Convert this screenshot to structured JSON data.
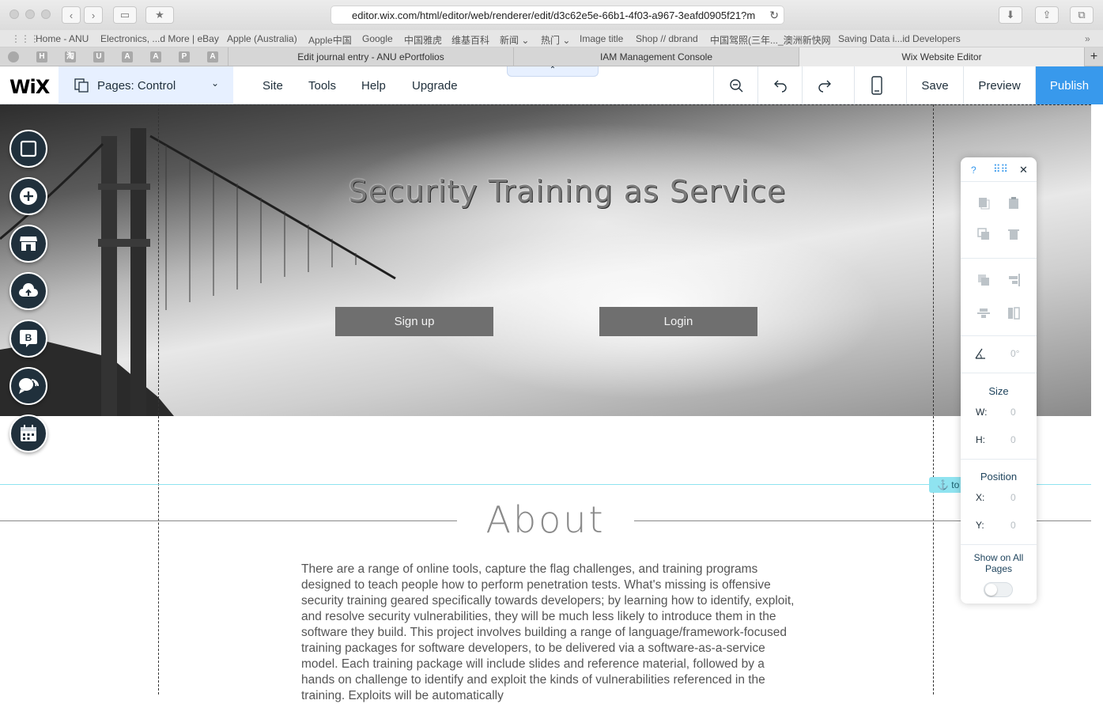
{
  "browser": {
    "url": "editor.wix.com/html/editor/web/renderer/edit/d3c62e5e-66b1-4f03-a967-3eafd0905f21?m",
    "bookmarks": [
      "Home - ANU",
      "Electronics, ...d More | eBay",
      "Apple (Australia)",
      "Apple中国",
      "Google",
      "中国雅虎",
      "维基百科",
      "新闻 ⌄",
      "热门 ⌄",
      "Image title",
      "Shop // dbrand",
      "中国驾照(三年..._澳洲新快网",
      "Saving Data i...id Developers"
    ],
    "pinned_tabs": [
      "",
      "H",
      "淘",
      "U",
      "A",
      "A",
      "P",
      "A"
    ],
    "tabs": [
      {
        "label": "Edit journal entry - ANU ePortfolios",
        "active": false
      },
      {
        "label": "IAM Management Console",
        "active": false
      },
      {
        "label": "Wix Website Editor",
        "active": true
      }
    ]
  },
  "editor": {
    "logo": "WiX",
    "pages_label": "Pages: Control",
    "menu": [
      "Site",
      "Tools",
      "Help",
      "Upgrade"
    ],
    "save_label": "Save",
    "preview_label": "Preview",
    "publish_label": "Publish",
    "publish_color": "#3899ec"
  },
  "left_toolbar": [
    "background-icon",
    "add-icon",
    "store-icon",
    "upload-icon",
    "blog-icon",
    "chat-icon",
    "bookings-icon"
  ],
  "left_toolbar_blog_letter": "B",
  "hero": {
    "title": "Security Training as Service",
    "signup_label": "Sign up",
    "login_label": "Login"
  },
  "anchor_label": "to",
  "about": {
    "title": "About",
    "text": "There are a range of online tools, capture the flag challenges, and training programs designed to teach people how to perform penetration tests. What's missing is offensive security training geared specifically towards developers; by learning how to identify, exploit, and resolve security vulnerabilities, they will be much less likely to introduce them in the software they build. This project involves building a range of language/framework-focused training packages for software developers, to be delivered via a software-as-a-service model. Each training package will include slides and reference material, followed by a hands on challenge to identify and exploit the kinds of vulnerabilities referenced in the training. Exploits will be automatically"
  },
  "panel": {
    "help": "?",
    "angle": "0°",
    "size_title": "Size",
    "w_label": "W:",
    "w_value": "0",
    "h_label": "H:",
    "h_value": "0",
    "position_title": "Position",
    "x_label": "X:",
    "x_value": "0",
    "y_label": "Y:",
    "y_value": "0",
    "show_all": "Show on All Pages",
    "show_all_on": false
  }
}
